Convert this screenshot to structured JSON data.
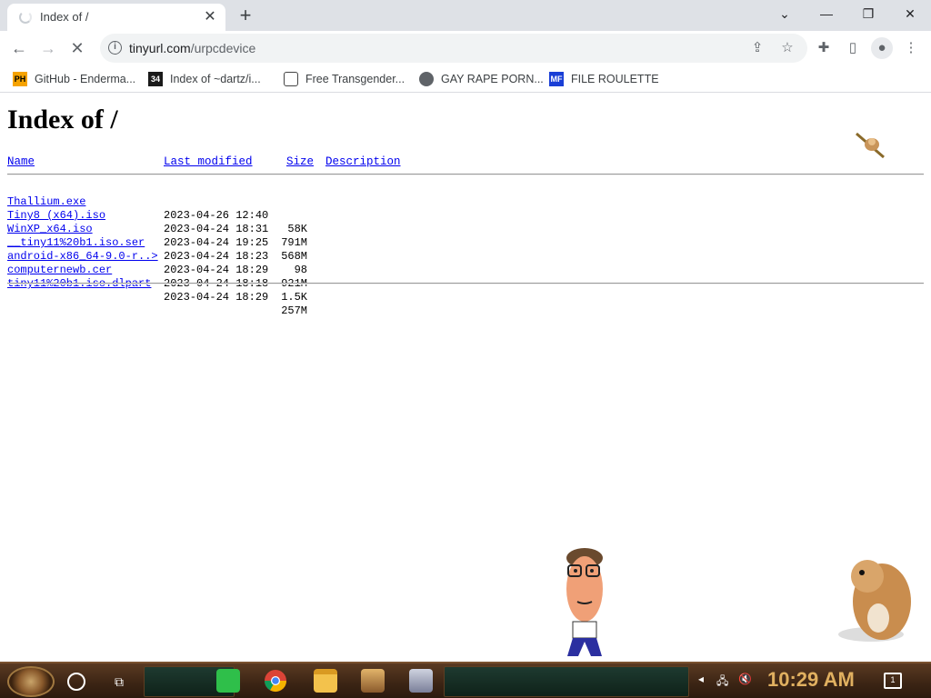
{
  "tab": {
    "title": "Index of /",
    "close": "✕",
    "new_tab": "+"
  },
  "window_controls": {
    "chevron": "⌄",
    "minimize": "—",
    "restore": "❐",
    "close": "✕"
  },
  "nav": {
    "back": "←",
    "forward": "→",
    "reload": "✕"
  },
  "omnibox": {
    "host": "tinyurl.com",
    "path": "/urpcdevice"
  },
  "bookmarks": [
    {
      "label": "GitHub - Enderma...",
      "icon": "PH"
    },
    {
      "label": "Index of ~dartz/i...",
      "icon": "34"
    },
    {
      "label": "Free Transgender...",
      "icon": ""
    },
    {
      "label": "GAY RAPE PORN...",
      "icon": ""
    },
    {
      "label": "FILE ROULETTE",
      "icon": "MF"
    }
  ],
  "page": {
    "heading": "Index of /",
    "columns": {
      "name": "Name",
      "modified": "Last modified",
      "size": "Size",
      "description": "Description"
    },
    "files": [
      {
        "name": "Thallium.exe",
        "modified": "2023-04-26 12:40",
        "size": "58K"
      },
      {
        "name": "Tiny8 (x64).iso",
        "modified": "2023-04-24 18:31",
        "size": "791M"
      },
      {
        "name": "WinXP_x64.iso",
        "modified": "2023-04-24 19:25",
        "size": "568M"
      },
      {
        "name": "__tiny11%20b1.iso.ser",
        "modified": "2023-04-24 18:23",
        "size": "98"
      },
      {
        "name": "android-x86_64-9.0-r..>",
        "modified": "2023-04-24 18:29",
        "size": "921M"
      },
      {
        "name": "computernewb.cer",
        "modified": "2023-04-24 18:18",
        "size": "1.5K"
      },
      {
        "name": "tiny11%20b1.iso.dlpart",
        "modified": "2023-04-24 18:29",
        "size": "257M"
      }
    ]
  },
  "taskbar": {
    "clock": "10:29 AM",
    "notification_count": "1"
  }
}
